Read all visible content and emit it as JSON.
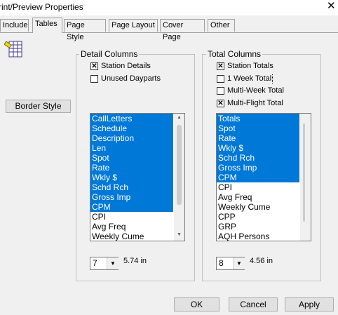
{
  "window": {
    "title": "rint/Preview Properties",
    "close_glyph": "✕"
  },
  "tabs": [
    {
      "label": "Include"
    },
    {
      "label": "Tables"
    },
    {
      "label": "Page Style"
    },
    {
      "label": "Page Layout"
    },
    {
      "label": "Cover Page"
    },
    {
      "label": "Other"
    }
  ],
  "active_tab": "Tables",
  "border_style_button": "Border Style",
  "detail_columns": {
    "title": "Detail Columns",
    "checkboxes": [
      {
        "label": "Station Details",
        "checked": true,
        "mark": "✕"
      },
      {
        "label": "Unused Dayparts",
        "checked": false,
        "mark": ""
      }
    ],
    "list_items": [
      {
        "text": "CallLetters",
        "selected": true
      },
      {
        "text": "Schedule",
        "selected": true
      },
      {
        "text": "Description",
        "selected": true
      },
      {
        "text": "Len",
        "selected": true
      },
      {
        "text": "Spot",
        "selected": true
      },
      {
        "text": "Rate",
        "selected": true
      },
      {
        "text": "Wkly $",
        "selected": true
      },
      {
        "text": "Schd Rch",
        "selected": true
      },
      {
        "text": "Gross Imp",
        "selected": true
      },
      {
        "text": "CPM",
        "selected": true
      },
      {
        "text": "CPI",
        "selected": false
      },
      {
        "text": "Avg Freq",
        "selected": false
      },
      {
        "text": "Weekly Cume",
        "selected": false
      }
    ],
    "size_select": {
      "value": "7",
      "arrow": "▼"
    },
    "width_text": "5.74 in"
  },
  "total_columns": {
    "title": "Total Columns",
    "checkboxes": [
      {
        "label": "Station Totals",
        "checked": true,
        "mark": "✕"
      },
      {
        "label": "1 Week Total",
        "checked": false,
        "mark": ""
      },
      {
        "label": "Multi-Week Total",
        "checked": false,
        "mark": ""
      },
      {
        "label": "Multi-Flight Total",
        "checked": true,
        "mark": "✕"
      }
    ],
    "list_items": [
      {
        "text": "Totals",
        "selected": true
      },
      {
        "text": "Spot",
        "selected": true
      },
      {
        "text": "Rate",
        "selected": true
      },
      {
        "text": "Wkly $",
        "selected": true
      },
      {
        "text": "Schd Rch",
        "selected": true
      },
      {
        "text": "Gross Imp",
        "selected": true
      },
      {
        "text": "CPM",
        "selected": true
      },
      {
        "text": "CPI",
        "selected": false
      },
      {
        "text": "Avg Freq",
        "selected": false
      },
      {
        "text": "Weekly Cume",
        "selected": false
      },
      {
        "text": "CPP",
        "selected": false
      },
      {
        "text": "GRP",
        "selected": false
      },
      {
        "text": "AQH Persons",
        "selected": false
      }
    ],
    "size_select": {
      "value": "8",
      "arrow": "▼"
    },
    "width_text": "4.56 in"
  },
  "buttons": {
    "ok": "OK",
    "cancel": "Cancel",
    "apply": "Apply"
  },
  "scroll": {
    "up": "▲",
    "down": "▼"
  },
  "colors": {
    "selection": "#0078d7",
    "window_bg": "#f0f0f0"
  }
}
